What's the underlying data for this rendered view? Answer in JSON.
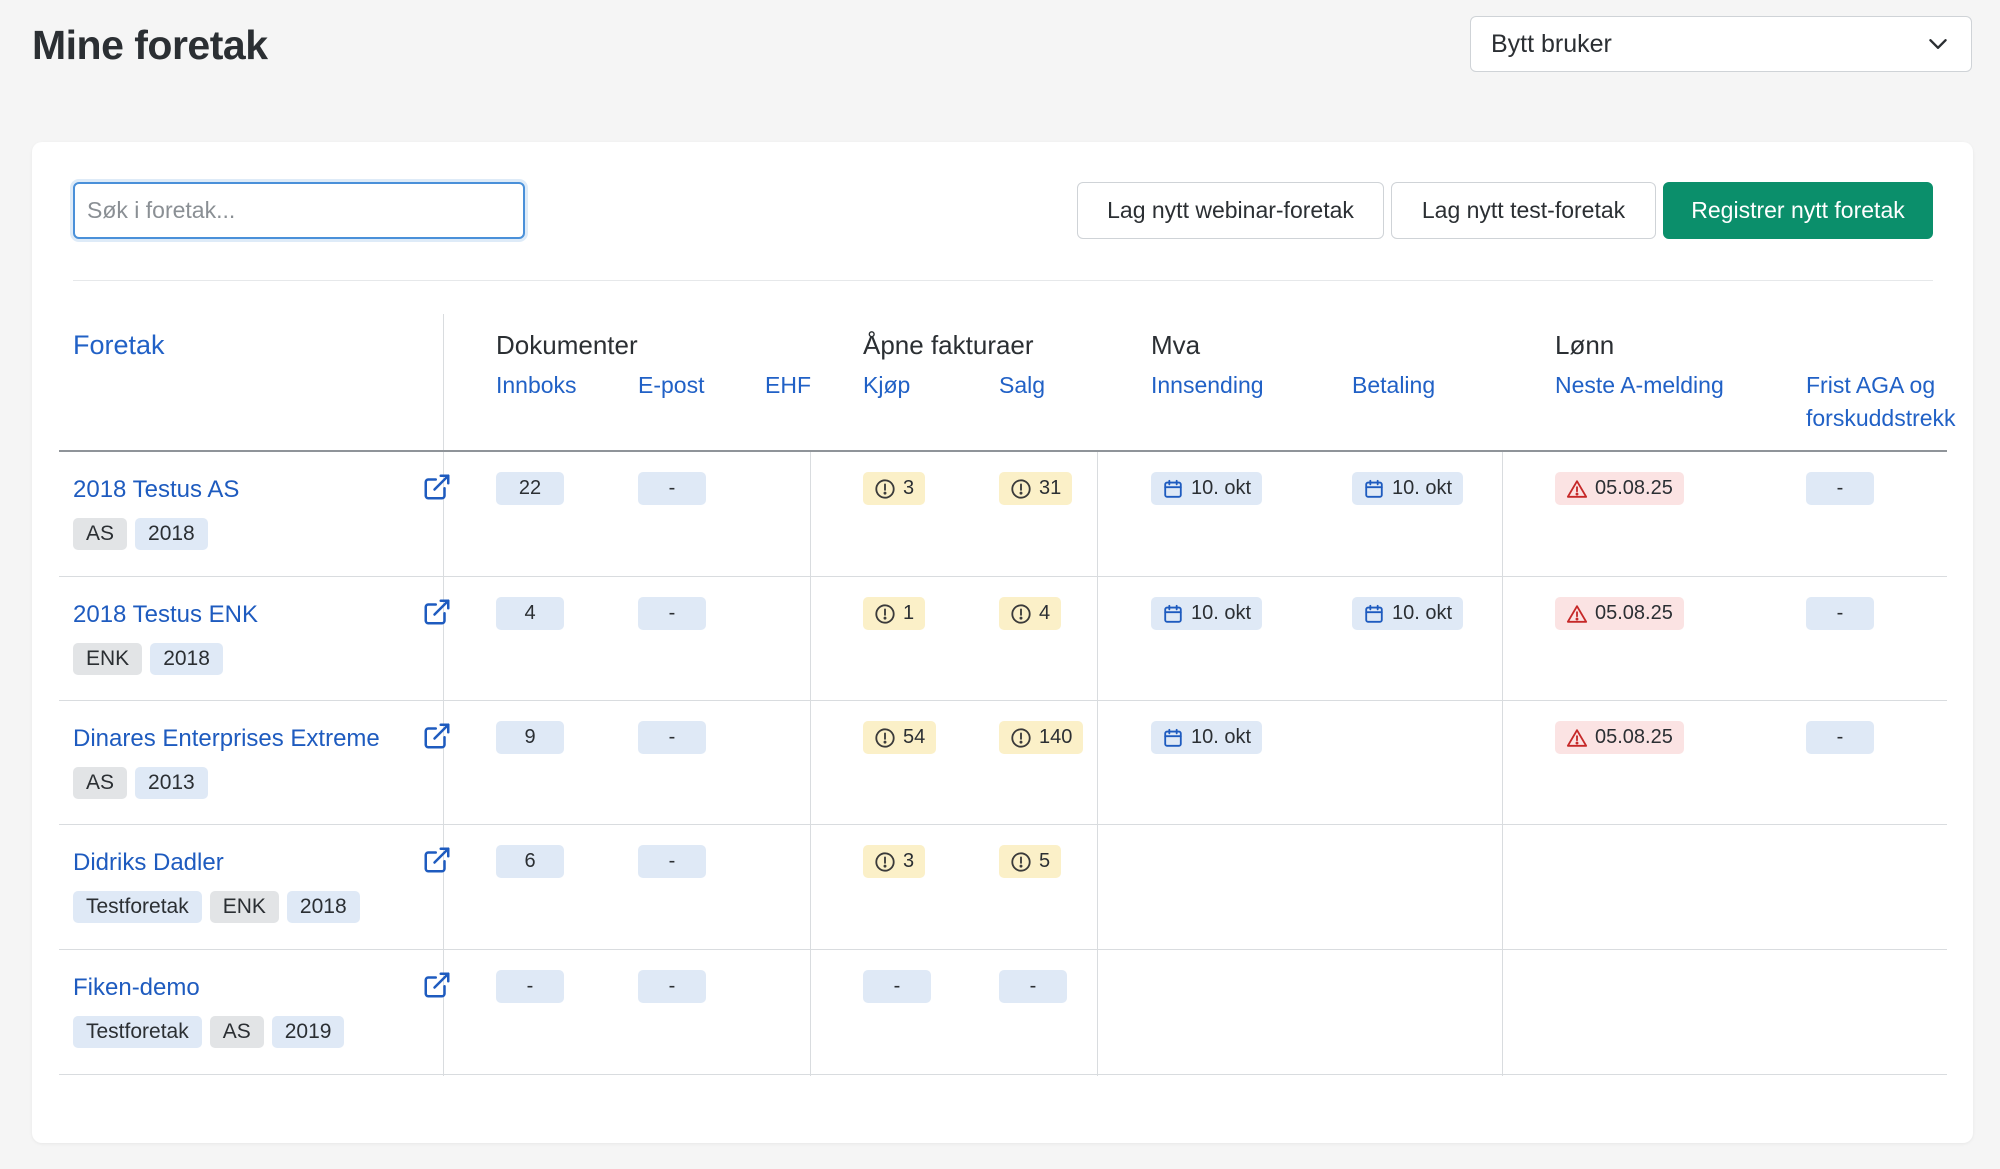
{
  "header": {
    "title": "Mine foretak",
    "user_select": "Bytt bruker"
  },
  "toolbar": {
    "search_placeholder": "Søk i foretak...",
    "btn_webinar": "Lag nytt webinar-foretak",
    "btn_test": "Lag nytt test-foretak",
    "btn_register": "Registrer nytt foretak"
  },
  "colors": {
    "link": "#2161c6",
    "primary": "#0b8f6b",
    "pill_blue": "#dfe9f6",
    "pill_yellow": "#fbf0c8",
    "pill_red": "#fbe3e3"
  },
  "columns": {
    "foretak": "Foretak",
    "dokumenter": {
      "title": "Dokumenter",
      "innboks": "Innboks",
      "epost": "E-post",
      "ehf": "EHF"
    },
    "fakturaer": {
      "title": "Åpne fakturaer",
      "kjop": "Kjøp",
      "salg": "Salg"
    },
    "mva": {
      "title": "Mva",
      "innsending": "Innsending",
      "betaling": "Betaling"
    },
    "lonn": {
      "title": "Lønn",
      "a_melding": "Neste A-melding",
      "frist_line1": "Frist AGA og",
      "frist_line2": "forskuddstrekk"
    }
  },
  "rows": [
    {
      "name": "2018 Testus AS",
      "tags": [
        "AS",
        "2018"
      ],
      "innboks": "22",
      "epost": "-",
      "kjop": "3",
      "salg": "31",
      "mva_innsending": "10. okt",
      "mva_betaling": "10. okt",
      "a_melding": "05.08.25",
      "frist": "-"
    },
    {
      "name": "2018 Testus ENK",
      "tags": [
        "ENK",
        "2018"
      ],
      "innboks": "4",
      "epost": "-",
      "kjop": "1",
      "salg": "4",
      "mva_innsending": "10. okt",
      "mva_betaling": "10. okt",
      "a_melding": "05.08.25",
      "frist": "-"
    },
    {
      "name": "Dinares Enterprises Extreme",
      "tags": [
        "AS",
        "2013"
      ],
      "innboks": "9",
      "epost": "-",
      "kjop": "54",
      "salg": "140",
      "mva_innsending": "10. okt",
      "a_melding": "05.08.25",
      "frist": "-"
    },
    {
      "name": "Didriks Dadler",
      "tags": [
        "Testforetak",
        "ENK",
        "2018"
      ],
      "innboks": "6",
      "epost": "-",
      "kjop": "3",
      "salg": "5"
    },
    {
      "name": "Fiken-demo",
      "tags": [
        "Testforetak",
        "AS",
        "2019"
      ],
      "innboks": "-",
      "epost": "-",
      "kjop": "-",
      "salg": "-"
    }
  ]
}
